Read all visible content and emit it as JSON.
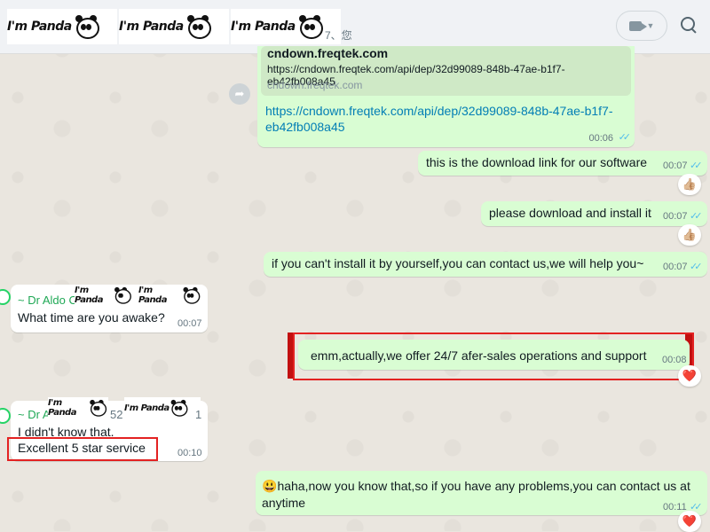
{
  "header": {
    "sticker_text": "I'm Panda",
    "subtitle": "7、您"
  },
  "chat": {
    "m1": {
      "preview_title": "cndown.freqtek.com",
      "preview_url": "https://cndown.freqtek.com/api/dep/32d99089-848b-47ae-b1f7-eb42fb008a45",
      "preview_domain": "cndown.freqtek.com",
      "link_text": "https://cndown.freqtek.com/api/dep/32d99089-848b-47ae-b1f7-eb42fb008a45",
      "time": "00:06"
    },
    "m2": {
      "text": "this is the download link for our software",
      "time": "00:07",
      "reaction": "👍🏼"
    },
    "m3": {
      "text": "please download and install it",
      "time": "00:07",
      "reaction": "👍🏼"
    },
    "m4": {
      "text": "if you can't install it by yourself,you can contact us,we will help you~",
      "time": "00:07"
    },
    "m5": {
      "sender": "~ Dr Aldo C",
      "text": "What time are you awake?",
      "time": "00:07",
      "sticker_text": "I'm Panda"
    },
    "m6": {
      "text": "emm,actually,we offer 24/7 afer-sales operations and support",
      "time": "00:08"
    },
    "m7": {
      "sender": "~ Dr A",
      "sender_suffix": "52",
      "sender_tail": "1",
      "line1": "I didn't know that.",
      "line2": "Excellent 5 star service",
      "time": "00:10",
      "sticker_text": "I'm Panda"
    },
    "m8": {
      "emoji": "😃",
      "text": "haha,now you know that,so if you have any problems,you can contact us at anytime",
      "time": "00:11",
      "reaction": "❤️"
    }
  },
  "icons": {
    "video_call": "video-camera-icon",
    "search": "search-icon",
    "forward": "forward-icon",
    "read_receipt": "double-check-icon"
  },
  "colors": {
    "outgoing_bubble": "#d9fdd3",
    "incoming_bubble": "#ffffff",
    "link": "#027eb5",
    "highlight_red": "#e32222"
  }
}
